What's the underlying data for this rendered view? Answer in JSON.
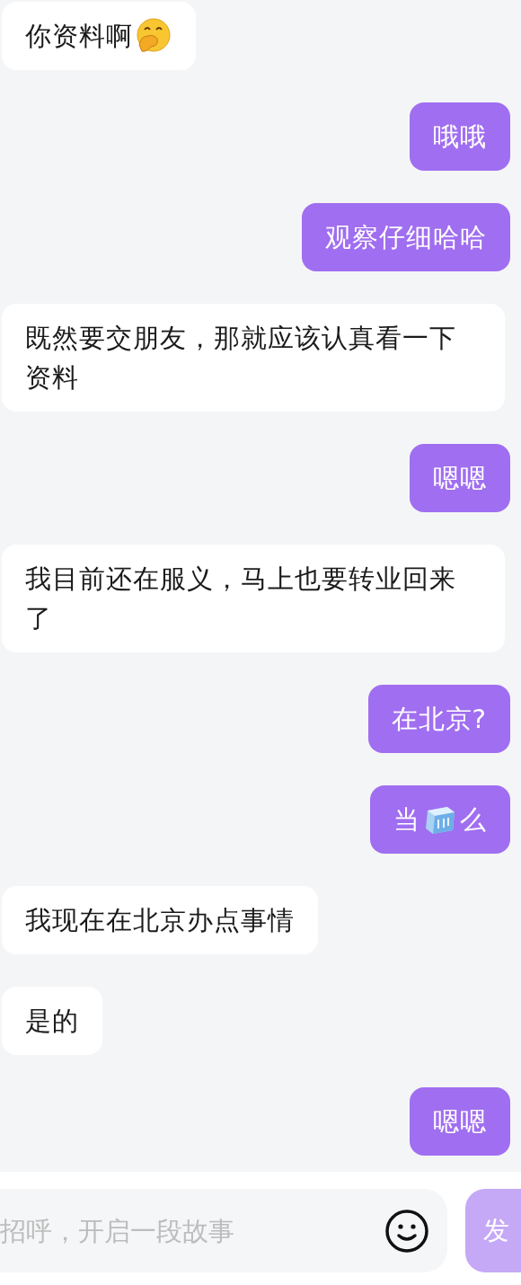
{
  "messages": [
    {
      "kind": "received",
      "parts": [
        {
          "kind": "text",
          "text": "你资料啊"
        },
        {
          "kind": "smiley"
        }
      ]
    },
    {
      "kind": "sent",
      "parts": [
        {
          "kind": "text",
          "text": "哦哦"
        }
      ]
    },
    {
      "kind": "sent",
      "parts": [
        {
          "kind": "text",
          "text": "观察仔细哈哈"
        }
      ]
    },
    {
      "kind": "received",
      "parts": [
        {
          "kind": "text",
          "text": "既然要交朋友，那就应该认真看一下资料"
        }
      ]
    },
    {
      "kind": "sent",
      "parts": [
        {
          "kind": "text",
          "text": "嗯嗯"
        }
      ]
    },
    {
      "kind": "received",
      "parts": [
        {
          "kind": "text",
          "text": "我目前还在服义，马上也要转业回来了"
        }
      ]
    },
    {
      "kind": "sent",
      "parts": [
        {
          "kind": "text",
          "text": "在北京?"
        }
      ]
    },
    {
      "kind": "sent",
      "parts": [
        {
          "kind": "text",
          "text": "当"
        },
        {
          "kind": "ice"
        },
        {
          "kind": "text",
          "text": "么"
        }
      ]
    },
    {
      "kind": "received",
      "parts": [
        {
          "kind": "text",
          "text": "我现在在北京办点事情"
        }
      ]
    },
    {
      "kind": "received",
      "parts": [
        {
          "kind": "text",
          "text": "是的"
        }
      ]
    },
    {
      "kind": "sent",
      "parts": [
        {
          "kind": "text",
          "text": "嗯嗯"
        }
      ]
    }
  ],
  "composer": {
    "placeholder": "招呼，开启一段故事",
    "send": "发"
  }
}
